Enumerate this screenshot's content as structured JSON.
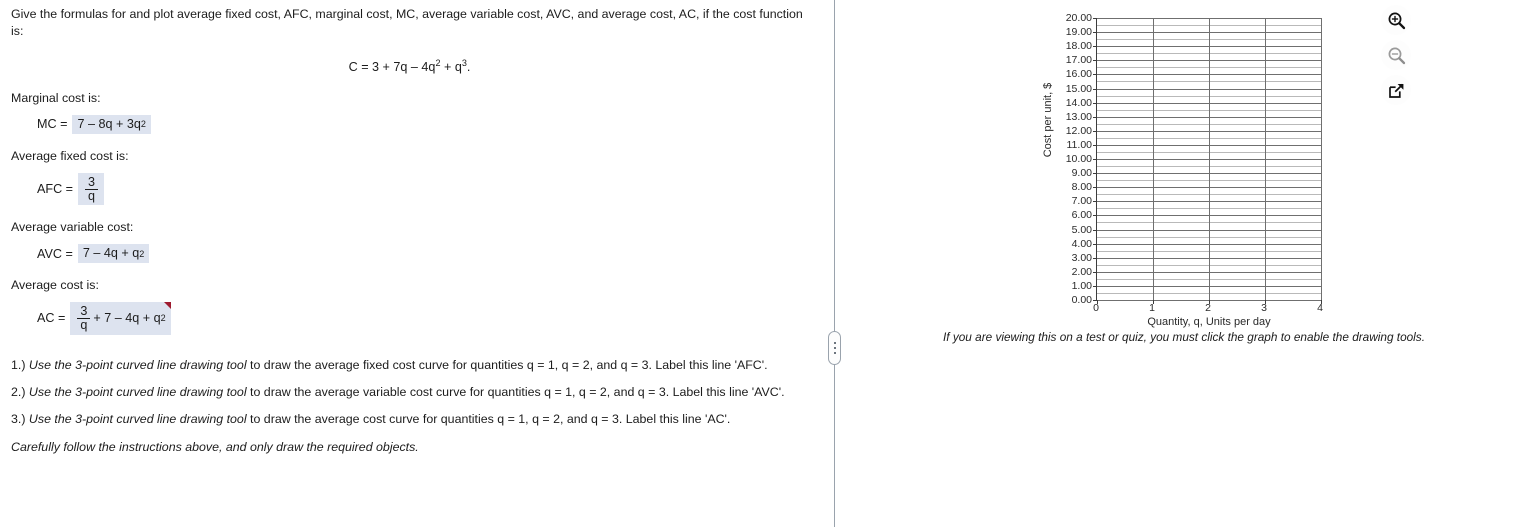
{
  "question": {
    "prompt": "Give the formulas for and plot average fixed cost, AFC, marginal cost, MC, average variable cost, AVC, and average cost, AC, if the cost function is:",
    "cost_function": {
      "lead": "C = 3 + 7q – 4q",
      "exp1": "2",
      "mid": " + q",
      "exp2": "3",
      "tail": "."
    },
    "answers": [
      {
        "label": "Marginal cost is:",
        "lead": "MC =",
        "value_text": "7 – 8q + 3q",
        "exponent": "2",
        "has_fraction": false,
        "flagged": false
      },
      {
        "label": "Average fixed cost is:",
        "lead": "AFC =",
        "numerator": "3",
        "denominator": "q",
        "value_text": "",
        "exponent": "",
        "has_fraction": true,
        "flagged": false
      },
      {
        "label": "Average variable cost:",
        "lead": "AVC =",
        "value_text": "7 – 4q + q",
        "exponent": "2",
        "has_fraction": false,
        "flagged": false
      },
      {
        "label": "Average cost is:",
        "lead": "AC =",
        "numerator": "3",
        "denominator": "q",
        "value_text": "+ 7 – 4q + q",
        "exponent": "2",
        "has_fraction": true,
        "flagged": true
      }
    ],
    "instructions": [
      {
        "number": "1.)",
        "tool": "Use the 3-point curved line drawing tool",
        "rest": " to draw the average fixed cost curve for quantities q = 1, q = 2, and q = 3. Label this line 'AFC'."
      },
      {
        "number": "2.)",
        "tool": "Use the 3-point curved line drawing tool",
        "rest": " to draw the average variable cost curve for quantities q = 1, q = 2, and q = 3. Label this line 'AVC'."
      },
      {
        "number": "3.)",
        "tool": "Use the 3-point curved line drawing tool",
        "rest": " to draw the average cost curve for quantities q = 1, q = 2, and q = 3. Label this line 'AC'."
      }
    ],
    "closing_note": "Carefully follow the instructions above, and only draw the required objects."
  },
  "graph": {
    "note": "If you are viewing this on a test or quiz, you must click the graph to enable the drawing tools.",
    "toolbar": [
      {
        "name": "zoom-in-icon",
        "label": "Zoom in",
        "state": "enabled"
      },
      {
        "name": "zoom-out-icon",
        "label": "Zoom out",
        "state": "disabled"
      },
      {
        "name": "expand-icon",
        "label": "Open graph in new window",
        "state": "enabled"
      }
    ],
    "colors": {
      "highlight": "#dde3ef",
      "flag": "#9e1b2f",
      "axis": "#3c3c3c",
      "gridline_major": "#6f6f6f",
      "gridline_minor": "#b9b9b9"
    }
  },
  "chart_data": {
    "type": "line",
    "title": "",
    "xlabel": "Quantity, q, Units per day",
    "ylabel": "Cost per unit, $",
    "xlim": [
      0,
      4
    ],
    "ylim": [
      0,
      20
    ],
    "x_ticks": [
      "0",
      "1",
      "2",
      "3",
      "4"
    ],
    "y_ticks": [
      "0.00",
      "1.00",
      "2.00",
      "3.00",
      "4.00",
      "5.00",
      "6.00",
      "7.00",
      "8.00",
      "9.00",
      "10.00",
      "11.00",
      "12.00",
      "13.00",
      "14.00",
      "15.00",
      "16.00",
      "17.00",
      "18.00",
      "19.00",
      "20.00"
    ],
    "grid": true,
    "minor_grid": true,
    "legend": null,
    "series": [],
    "annotations": []
  }
}
